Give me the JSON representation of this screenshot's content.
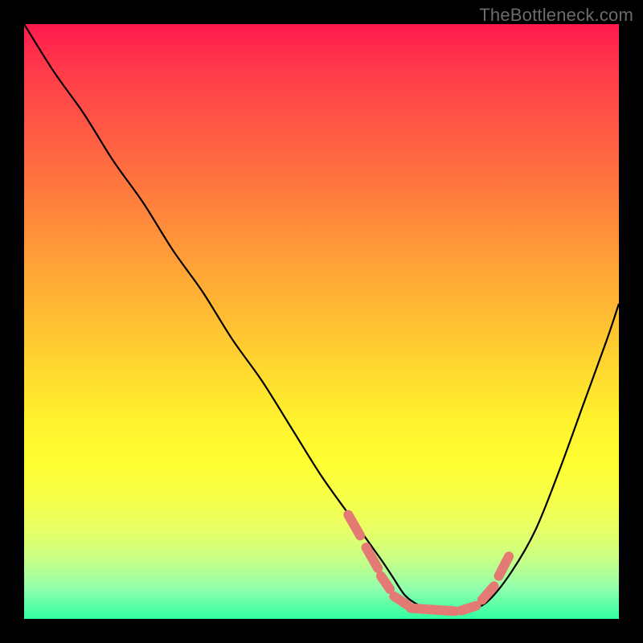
{
  "watermark": "TheBottleneck.com",
  "colors": {
    "curve_stroke": "#000000",
    "marker_stroke": "#e47a74",
    "gradient_top": "#ff1a4d",
    "gradient_bottom": "#30ffa0",
    "frame_background": "#000000"
  },
  "chart_data": {
    "type": "line",
    "title": "",
    "xlabel": "",
    "ylabel": "",
    "xlim": [
      0,
      100
    ],
    "ylim": [
      0,
      100
    ],
    "grid": false,
    "note": "Axes unlabeled; values read from pixel geometry. y=100 at top of plot, y=0 at bottom.",
    "series": [
      {
        "name": "curve",
        "x": [
          0,
          5,
          10,
          15,
          20,
          25,
          30,
          35,
          40,
          45,
          50,
          55,
          60,
          62,
          64,
          66,
          68,
          70,
          72,
          75,
          78,
          82,
          86,
          90,
          94,
          98,
          100
        ],
        "y": [
          100,
          92,
          85,
          77,
          70,
          62,
          55,
          47,
          40,
          32,
          24,
          17,
          10,
          7,
          4,
          2.5,
          1.6,
          1.2,
          1.2,
          1.6,
          3,
          8,
          15,
          25,
          36,
          47,
          53
        ]
      }
    ],
    "markers": {
      "name": "salmon-dashes",
      "note": "Short thick salmon segments tracing the valley of the curve.",
      "segments": [
        {
          "x1": 54.5,
          "y1": 17.5,
          "x2": 56.5,
          "y2": 14.0
        },
        {
          "x1": 57.5,
          "y1": 12.0,
          "x2": 59.5,
          "y2": 8.5
        },
        {
          "x1": 60.0,
          "y1": 7.2,
          "x2": 61.5,
          "y2": 5.0
        },
        {
          "x1": 62.2,
          "y1": 3.8,
          "x2": 64.5,
          "y2": 2.3
        },
        {
          "x1": 65.0,
          "y1": 1.8,
          "x2": 72.5,
          "y2": 1.3
        },
        {
          "x1": 73.5,
          "y1": 1.4,
          "x2": 76.0,
          "y2": 2.2
        },
        {
          "x1": 77.0,
          "y1": 3.2,
          "x2": 79.0,
          "y2": 5.5
        },
        {
          "x1": 79.8,
          "y1": 7.2,
          "x2": 81.5,
          "y2": 10.5
        }
      ]
    }
  }
}
